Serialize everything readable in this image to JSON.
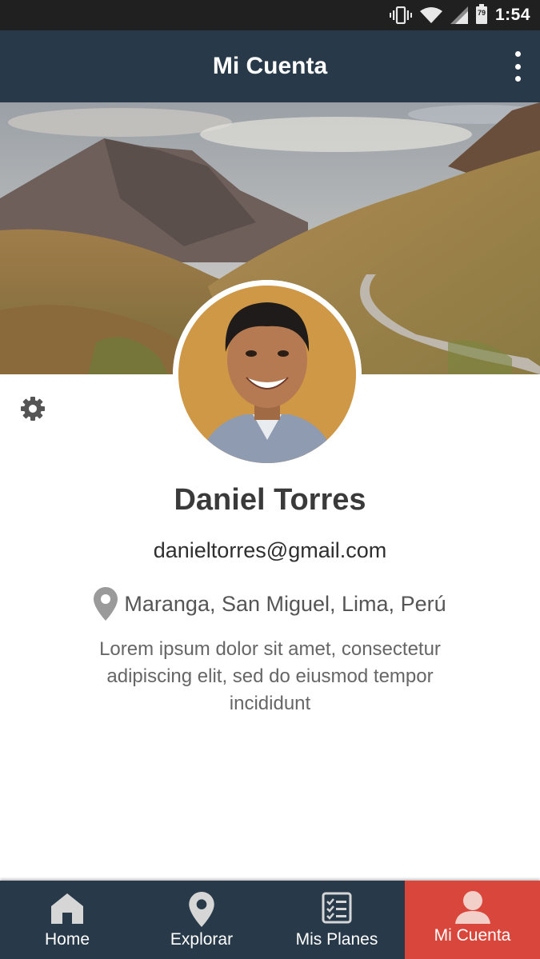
{
  "status_bar": {
    "time": "1:54",
    "battery_level": "79",
    "icons": [
      "vibrate-icon",
      "wifi-icon",
      "signal-icon",
      "battery-icon"
    ]
  },
  "app_bar": {
    "title": "Mi Cuenta",
    "menu_icon": "more-vert-icon"
  },
  "profile": {
    "name": "Daniel Torres",
    "email": "danieltorres@gmail.com",
    "location": "Maranga, San Miguel, Lima, Perú",
    "bio": "Lorem ipsum dolor sit amet, consectetur adipiscing elit, sed do eiusmod tempor incididunt",
    "settings_icon": "gear-icon"
  },
  "bottom_nav": {
    "tabs": [
      {
        "label": "Home",
        "icon": "home-icon",
        "active": false
      },
      {
        "label": "Explorar",
        "icon": "map-pin-icon",
        "active": false
      },
      {
        "label": "Mis Planes",
        "icon": "checklist-icon",
        "active": false
      },
      {
        "label": "Mi Cuenta",
        "icon": "user-icon",
        "active": true
      }
    ]
  },
  "colors": {
    "app_bar": "#283a4a",
    "status_bar": "#202020",
    "active_tab": "#d9473c",
    "inactive_icon": "#d6d6d6"
  }
}
